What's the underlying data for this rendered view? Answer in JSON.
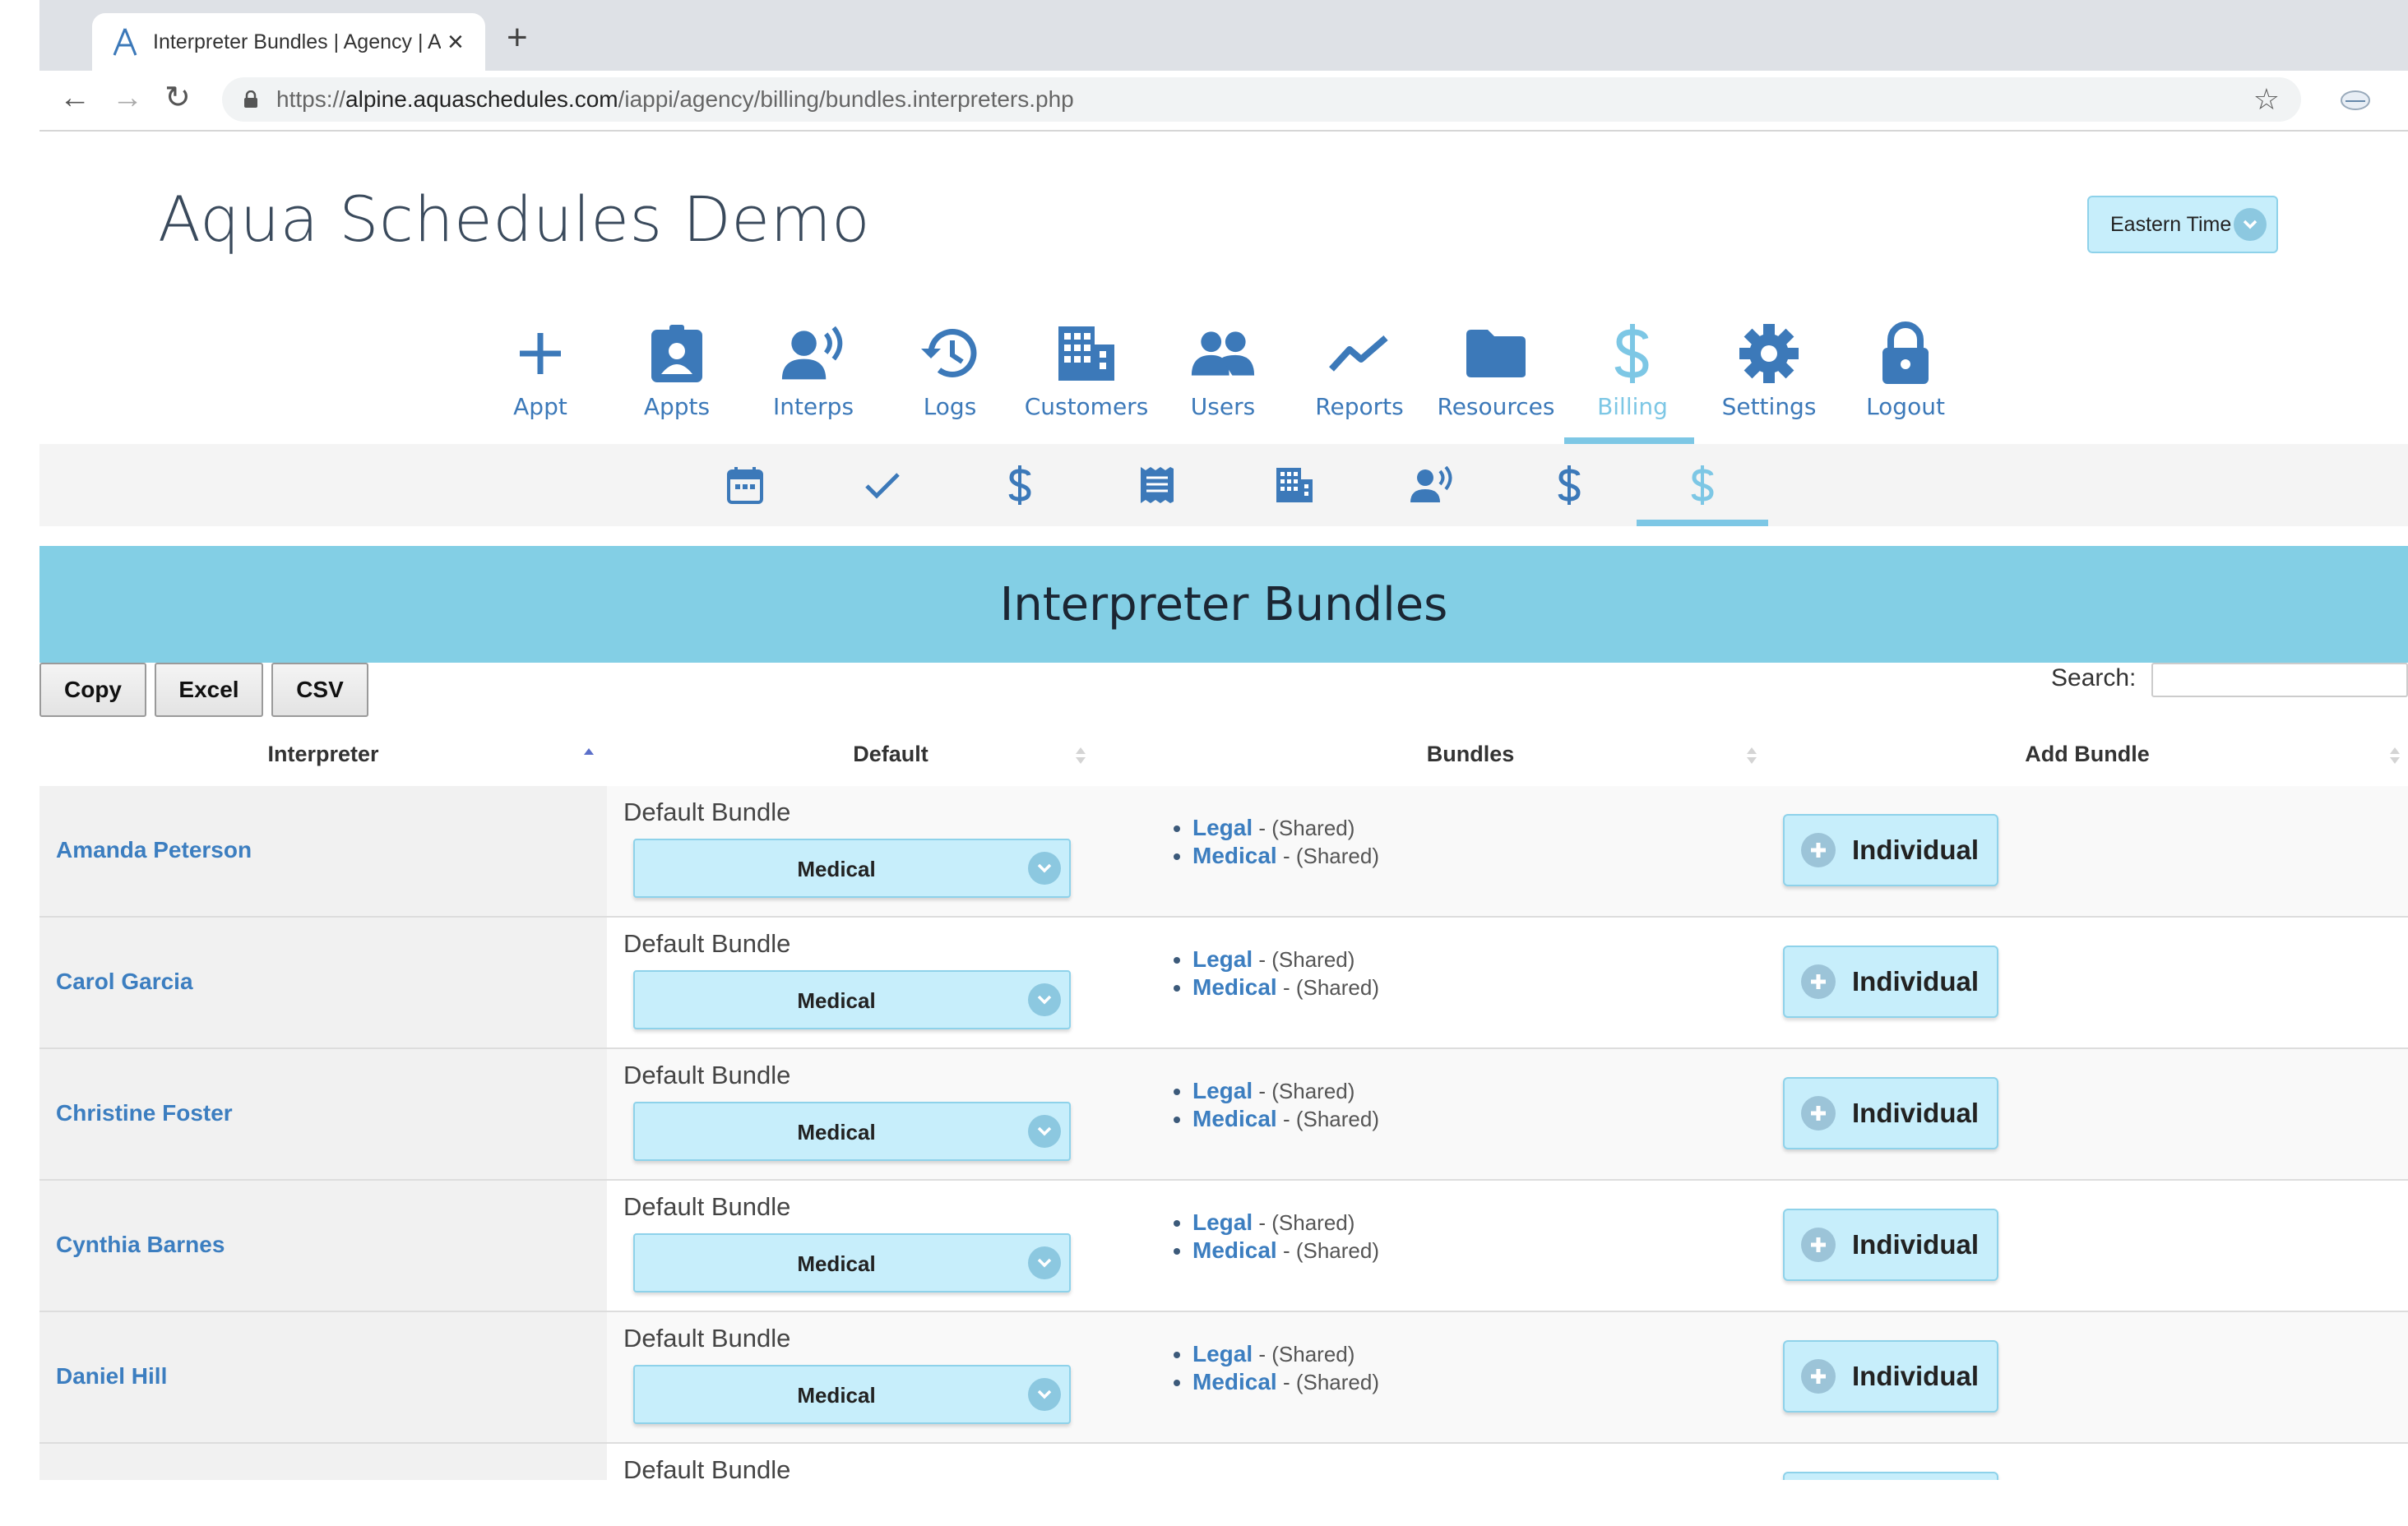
{
  "browser": {
    "tab_title": "Interpreter Bundles | Agency | Aqua",
    "url_prefix": "https://",
    "url_host": "alpine.aquaschedules.com",
    "url_path": "/iappi/agency/billing/bundles.interpreters.php"
  },
  "header": {
    "app_title": "Aqua Schedules Demo",
    "timezone": "Eastern Time"
  },
  "nav": [
    {
      "label": "Appt",
      "icon": "plus-icon"
    },
    {
      "label": "Appts",
      "icon": "id-badge-icon"
    },
    {
      "label": "Interps",
      "icon": "speaker-person-icon"
    },
    {
      "label": "Logs",
      "icon": "history-icon"
    },
    {
      "label": "Customers",
      "icon": "building-icon"
    },
    {
      "label": "Users",
      "icon": "users-icon"
    },
    {
      "label": "Reports",
      "icon": "line-chart-icon"
    },
    {
      "label": "Resources",
      "icon": "folder-icon"
    },
    {
      "label": "Billing",
      "icon": "dollar-icon",
      "active": true
    },
    {
      "label": "Settings",
      "icon": "gear-icon"
    },
    {
      "label": "Logout",
      "icon": "lock-icon"
    }
  ],
  "subnav": [
    "calendar-icon",
    "check-icon",
    "dollar-icon",
    "invoice-icon",
    "building-icon",
    "speaker-person-icon",
    "dollar-icon",
    "dollar-icon-active"
  ],
  "page": {
    "title": "Interpreter Bundles",
    "buttons": {
      "copy": "Copy",
      "excel": "Excel",
      "csv": "CSV"
    },
    "search_label": "Search:",
    "search_value": ""
  },
  "table": {
    "headers": {
      "interpreter": "Interpreter",
      "default": "Default",
      "bundles": "Bundles",
      "add_bundle": "Add Bundle"
    },
    "default_bundle_label": "Default Bundle",
    "add_label": "Individual",
    "rows": [
      {
        "name": "Amanda Peterson",
        "default": "Medical",
        "bundles": [
          {
            "name": "Legal",
            "scope": "- (Shared)"
          },
          {
            "name": "Medical",
            "scope": "- (Shared)"
          }
        ]
      },
      {
        "name": "Carol Garcia",
        "default": "Medical",
        "bundles": [
          {
            "name": "Legal",
            "scope": "- (Shared)"
          },
          {
            "name": "Medical",
            "scope": "- (Shared)"
          }
        ]
      },
      {
        "name": "Christine Foster",
        "default": "Medical",
        "bundles": [
          {
            "name": "Legal",
            "scope": "- (Shared)"
          },
          {
            "name": "Medical",
            "scope": "- (Shared)"
          }
        ]
      },
      {
        "name": "Cynthia Barnes",
        "default": "Medical",
        "bundles": [
          {
            "name": "Legal",
            "scope": "- (Shared)"
          },
          {
            "name": "Medical",
            "scope": "- (Shared)"
          }
        ]
      },
      {
        "name": "Daniel Hill",
        "default": "Medical",
        "bundles": [
          {
            "name": "Legal",
            "scope": "- (Shared)"
          },
          {
            "name": "Medical",
            "scope": "- (Shared)"
          }
        ]
      },
      {
        "name": "",
        "default": "",
        "bundles": []
      }
    ]
  },
  "colors": {
    "accent": "#3c79b9",
    "active": "#7dc7e5",
    "banner": "#83cfe5",
    "button_bg": "#c7eefb"
  }
}
